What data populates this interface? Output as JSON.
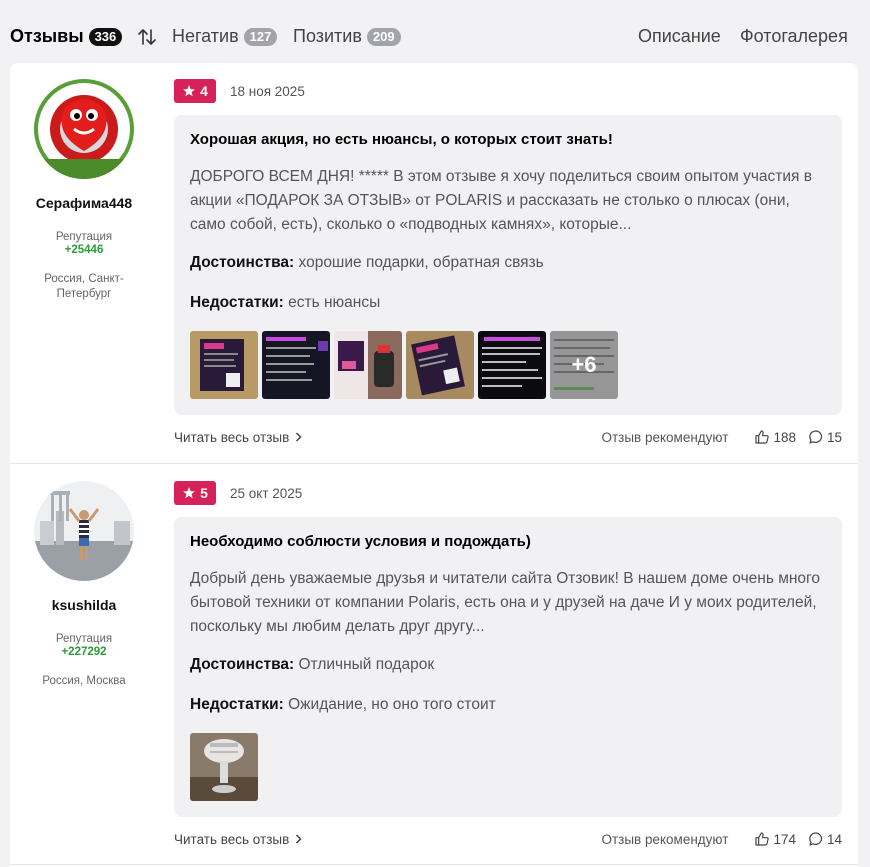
{
  "tabs": {
    "reviews": {
      "label": "Отзывы",
      "count": "336"
    },
    "negative": {
      "label": "Негатив",
      "count": "127"
    },
    "positive": {
      "label": "Позитив",
      "count": "209"
    },
    "description": "Описание",
    "gallery": "Фотогалерея"
  },
  "reviews": [
    {
      "author": {
        "name": "Серафима448",
        "reputation_label": "Репутация",
        "reputation": "+25446",
        "location": "Россия, Санкт-Петербург"
      },
      "rating": "4",
      "date": "18 ноя 2025",
      "title": "Хорошая акция, но есть нюансы, о которых стоит знать!",
      "text": "ДОБРОГО ВСЕМ ДНЯ! ***** В этом отзыве я хочу поделиться своим опытом участия в акции «ПОДАРОК ЗА ОТЗЫВ» от POLARIS и рассказать не столько о плюсах (они, само собой, есть), сколько о «подводных камнях», которые...",
      "pros_label": "Достоинства:",
      "pros": "хорошие подарки, обратная связь",
      "cons_label": "Недостатки:",
      "cons": "есть нюансы",
      "more_photos": "+6",
      "read_more": "Читать весь отзыв",
      "recommend": "Отзыв рекомендуют",
      "likes": "188",
      "comments": "15"
    },
    {
      "author": {
        "name": "ksushilda",
        "reputation_label": "Репутация",
        "reputation": "+227292",
        "location": "Россия, Москва"
      },
      "rating": "5",
      "date": "25 окт 2025",
      "title": "Необходимо соблюсти условия и подождать)",
      "text": "Добрый день уважаемые друзья и читатели сайта Отзовик! В нашем доме очень много бытовой техники от компании Polaris, есть она и у друзей на даче И у моих родителей, поскольку мы любим делать друг другу...",
      "pros_label": "Достоинства:",
      "pros": "Отличный подарок",
      "cons_label": "Недостатки:",
      "cons": "Ожидание, но оно того стоит",
      "read_more": "Читать весь отзыв",
      "recommend": "Отзыв рекомендуют",
      "likes": "174",
      "comments": "14"
    }
  ]
}
